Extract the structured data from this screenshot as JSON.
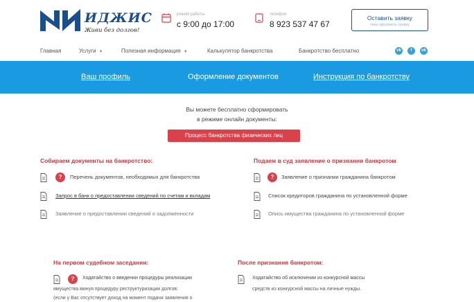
{
  "header": {
    "logo": {
      "name": "ИДЖИС",
      "tagline": "Живи без долгов!"
    },
    "hours": {
      "label": "режим работы",
      "value": "с 9:00 до 17:00"
    },
    "phone": {
      "label": "телефон",
      "value": "8 923 537 47 67"
    },
    "cta": {
      "title": "Оставить заявку",
      "subtitle": "Нам оформить заявку"
    }
  },
  "nav": {
    "items": [
      {
        "label": "Главная"
      },
      {
        "label": "Услуги"
      },
      {
        "label": "Полезная информация"
      },
      {
        "label": "Калькулятор банкротства"
      },
      {
        "label": "Банкротство бесплатно"
      }
    ],
    "social": [
      "vk",
      "f",
      "ok"
    ]
  },
  "band": {
    "links": [
      {
        "label": "Ваш профиль"
      },
      {
        "label": "Оформление документов"
      },
      {
        "label": "Инструкция по банкротству"
      }
    ]
  },
  "intro": {
    "line1": "Вы можете бесплатно сформировать",
    "line2": "в режиме онлайн документы:",
    "button": "Процесс банкротства физических лиц"
  },
  "left_section": {
    "title": "Собираем документы на банкротство:",
    "items": [
      {
        "text": "Перечень документов, необходимых для банкротства"
      },
      {
        "text": "Запрос в банк о предоставлении сведений по счетам и вкладам"
      },
      {
        "text": "Заявление о предоставлении сведений о задолженности"
      }
    ]
  },
  "right_section": {
    "title": "Подаем в суд заявление о признании банкротом",
    "items": [
      {
        "text": "Заявление о признании гражданина банкротом"
      },
      {
        "text": "Список кредиторов гражданина по установленной форме"
      },
      {
        "text": "Опись имущества гражданина по установленной форме"
      }
    ]
  },
  "bottom_left": {
    "title": "На первом судебном заседании:",
    "line1": "Ходатайство о введении процедуры реализации",
    "line2": "имущества минуя процедуру реструктуризации долгов:",
    "line3": "(если у Вас отсутствует доход на момент подачи заявления о"
  },
  "bottom_right": {
    "title": "После признания банкротом:",
    "line1": "Ходатайство об исключении из конкурсной массы",
    "line2": "средств из конкурсной массы на личные нужды."
  }
}
